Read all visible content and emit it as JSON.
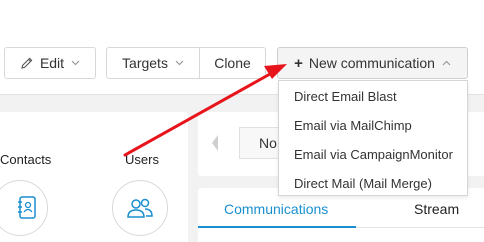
{
  "toolbar": {
    "edit_label": "Edit",
    "targets_label": "Targets",
    "clone_label": "Clone",
    "new_label": "New communication"
  },
  "dropdown": {
    "items": [
      {
        "label": "Direct Email Blast"
      },
      {
        "label": "Email via MailChimp"
      },
      {
        "label": "Email via CampaignMonitor"
      },
      {
        "label": "Direct Mail (Mail Merge)"
      }
    ]
  },
  "left_card": {
    "contacts_label": "Contacts",
    "users_label": "Users"
  },
  "middle": {
    "no_text": "No"
  },
  "tabs": [
    {
      "label": "Communications",
      "active": true
    },
    {
      "label": "Stream",
      "active": false
    }
  ],
  "colors": {
    "accent": "#1a8fcf",
    "annotation_arrow": "#e8141c"
  },
  "icons": {
    "edit": "pencil-icon",
    "chevron": "chevron-down-icon",
    "new": "plus-icon",
    "dropdown_open": "chevron-up-icon",
    "contacts": "address-book-icon",
    "users": "users-icon",
    "prev": "arrow-left-icon"
  }
}
